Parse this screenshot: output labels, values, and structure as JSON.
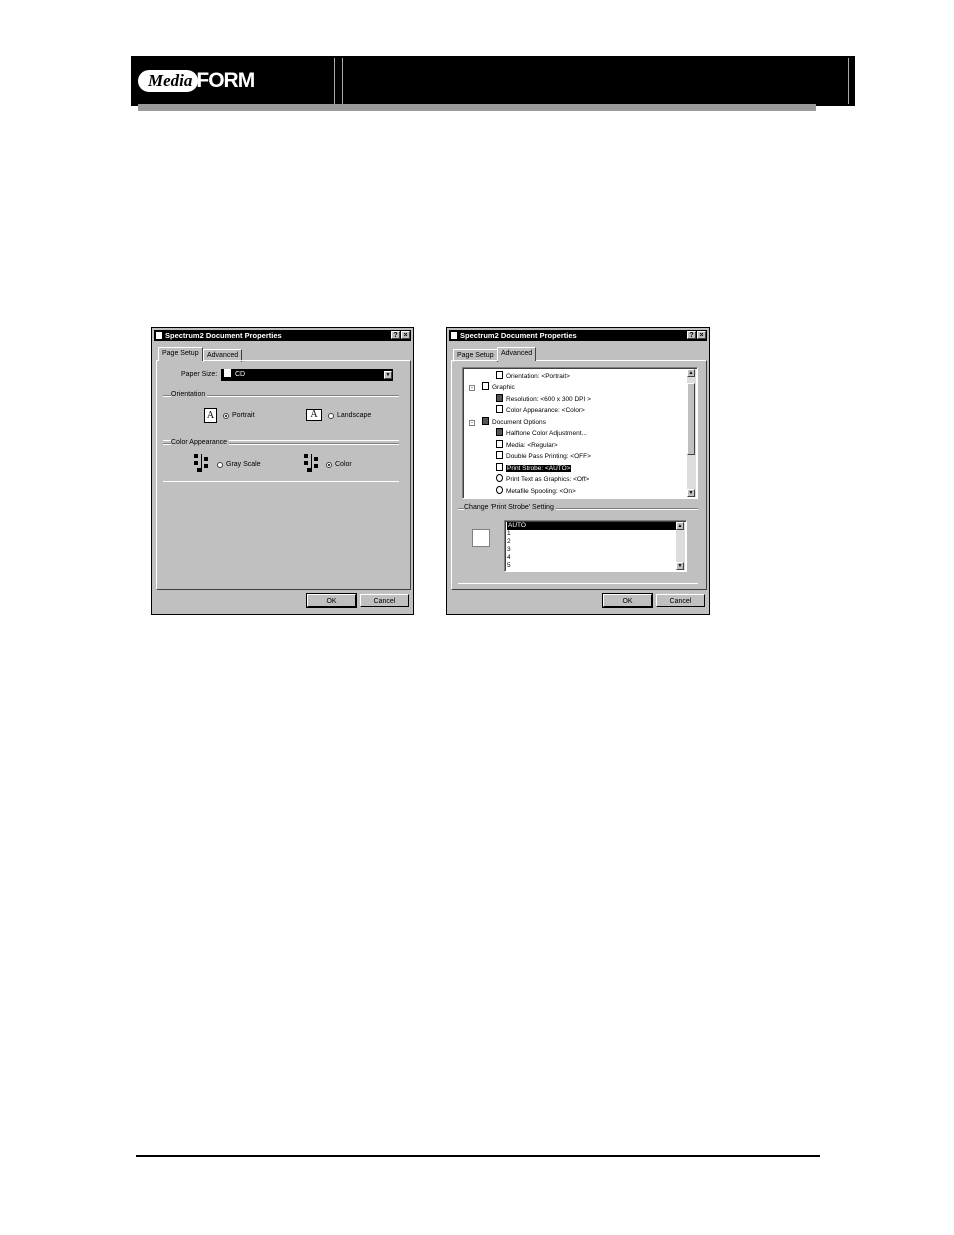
{
  "header": {
    "logo_media": "Media",
    "logo_form": "FORM"
  },
  "dialog_left": {
    "title": "Spectrum2 Document Properties",
    "help_btn": "?",
    "close_btn": "×",
    "tabs": [
      "Page Setup",
      "Advanced"
    ],
    "paper_size_label": "Paper Size:",
    "paper_size_value": "CD",
    "orientation_label": "Orientation",
    "orientation_options": [
      "Portrait",
      "Landscape"
    ],
    "orientation_icon_text": "A",
    "color_label": "Color Appearance",
    "color_options": [
      "Gray Scale",
      "Color"
    ],
    "ok": "OK",
    "cancel": "Cancel"
  },
  "dialog_right": {
    "title": "Spectrum2 Document Properties",
    "help_btn": "?",
    "close_btn": "×",
    "tabs": [
      "Page Setup",
      "Advanced"
    ],
    "tree": [
      "Orientation: <Portrait>",
      "Graphic",
      "Resolution: <600 x 300 DPI >",
      "Color Appearance: <Color>",
      "Document Options",
      "Halftone Color Adjustment...",
      "Media: <Regular>",
      "Double Pass Printing: <OFF>",
      "Print Strobe: <AUTO>",
      "Print Text as Graphics: <Off>",
      "Metafile Spooling: <On>"
    ],
    "change_label": "Change 'Print Strobe' Setting",
    "list_items": [
      "AUTO",
      "1",
      "2",
      "3",
      "4",
      "5"
    ],
    "ok": "OK",
    "cancel": "Cancel"
  }
}
